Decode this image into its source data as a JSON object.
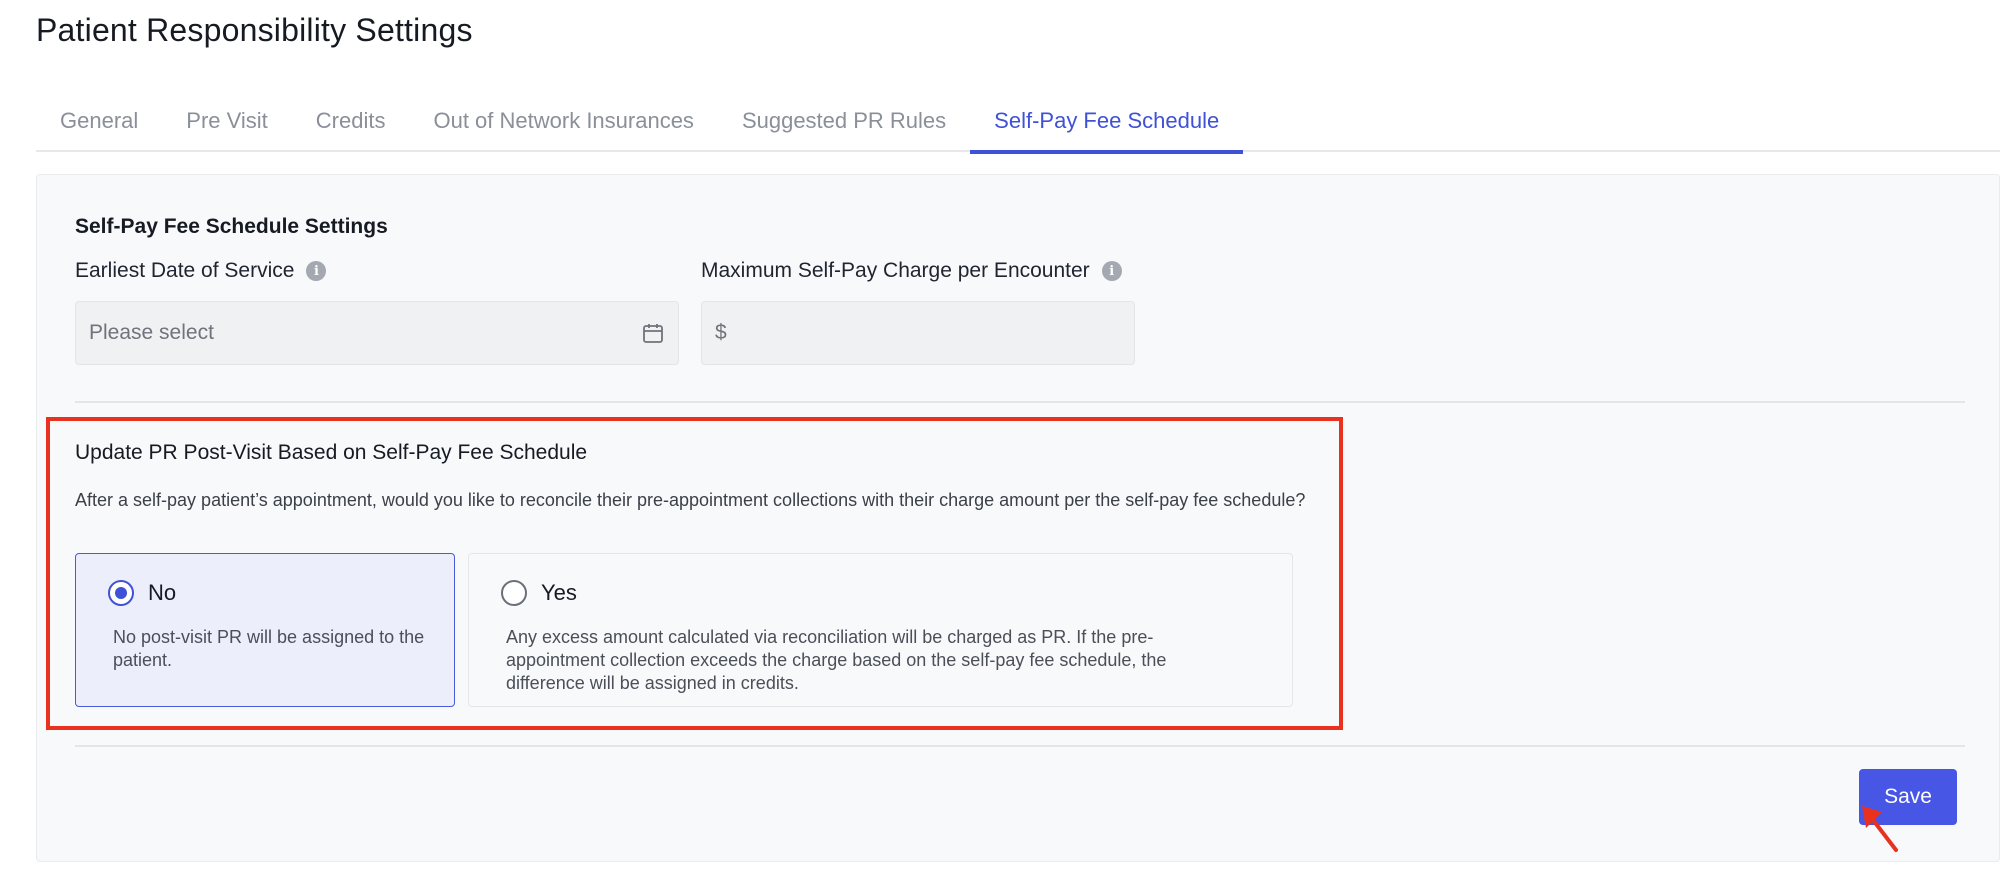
{
  "page": {
    "title": "Patient Responsibility Settings"
  },
  "tabs": [
    {
      "label": "General"
    },
    {
      "label": "Pre Visit"
    },
    {
      "label": "Credits"
    },
    {
      "label": "Out of Network Insurances"
    },
    {
      "label": "Suggested PR Rules"
    },
    {
      "label": "Self-Pay Fee Schedule",
      "active": true
    }
  ],
  "settings": {
    "section_title": "Self-Pay Fee Schedule Settings",
    "earliest_date": {
      "label": "Earliest Date of Service",
      "placeholder": "Please select",
      "icon": "calendar-icon"
    },
    "max_charge": {
      "label": "Maximum Self-Pay Charge per Encounter",
      "prefix": "$",
      "value": ""
    }
  },
  "pr_update": {
    "title": "Update PR Post-Visit Based on Self-Pay Fee Schedule",
    "description": "After a self-pay patient’s appointment, would you like to reconcile their pre-appointment collections with their charge amount per the self-pay fee schedule?",
    "options": [
      {
        "label": "No",
        "description": "No post-visit PR will be assigned to the patient.",
        "selected": true
      },
      {
        "label": "Yes",
        "description": "Any excess amount calculated via reconciliation will be charged as PR. If the pre-appointment collection exceeds the charge based on the self-pay fee schedule, the difference will be assigned in credits.",
        "selected": false
      }
    ]
  },
  "actions": {
    "save_label": "Save"
  },
  "colors": {
    "accent": "#3f51d6",
    "save_button": "#4856e6",
    "highlight": "#e8321f"
  }
}
